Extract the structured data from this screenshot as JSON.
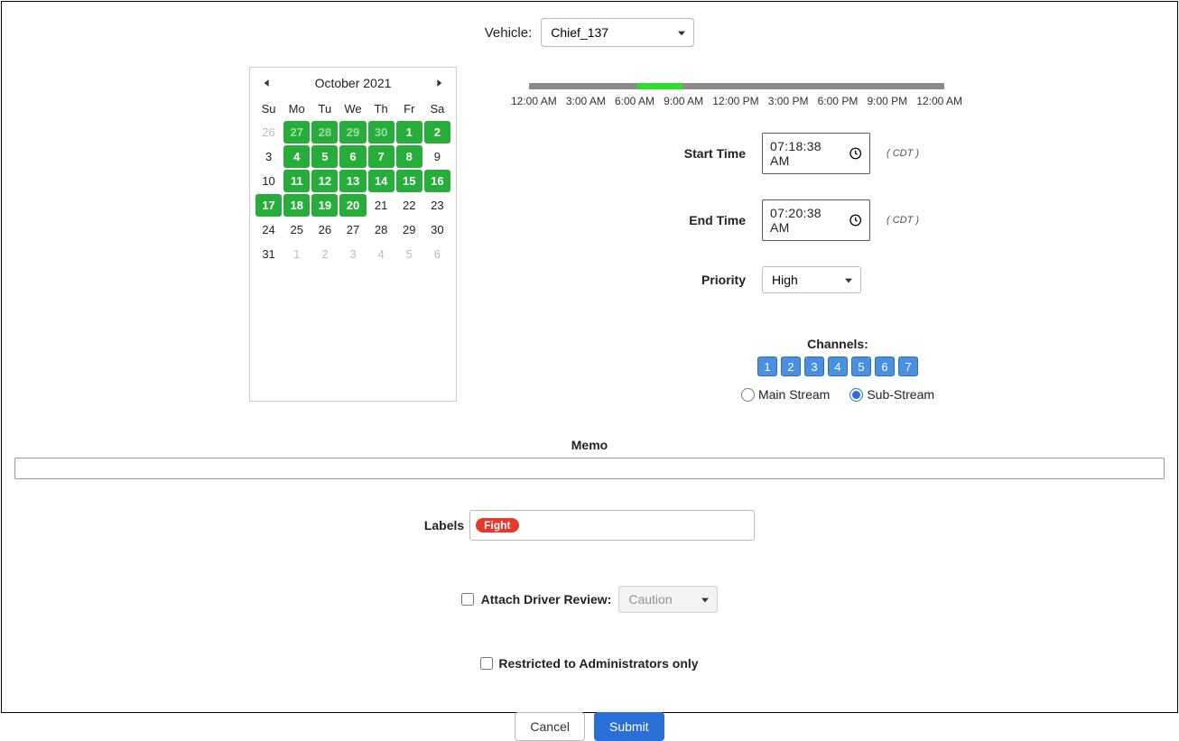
{
  "vehicle": {
    "label": "Vehicle:",
    "selected": "Chief_137"
  },
  "calendar": {
    "title": "October 2021",
    "dow": [
      "Su",
      "Mo",
      "Tu",
      "We",
      "Th",
      "Fr",
      "Sa"
    ],
    "days": [
      {
        "n": "26",
        "cls": "muted"
      },
      {
        "n": "27",
        "cls": "avail dim"
      },
      {
        "n": "28",
        "cls": "avail dim"
      },
      {
        "n": "29",
        "cls": "avail dim"
      },
      {
        "n": "30",
        "cls": "avail dim"
      },
      {
        "n": "1",
        "cls": "avail"
      },
      {
        "n": "2",
        "cls": "avail"
      },
      {
        "n": "3",
        "cls": ""
      },
      {
        "n": "4",
        "cls": "avail"
      },
      {
        "n": "5",
        "cls": "avail"
      },
      {
        "n": "6",
        "cls": "avail"
      },
      {
        "n": "7",
        "cls": "avail"
      },
      {
        "n": "8",
        "cls": "avail"
      },
      {
        "n": "9",
        "cls": ""
      },
      {
        "n": "10",
        "cls": ""
      },
      {
        "n": "11",
        "cls": "avail"
      },
      {
        "n": "12",
        "cls": "avail"
      },
      {
        "n": "13",
        "cls": "avail"
      },
      {
        "n": "14",
        "cls": "avail"
      },
      {
        "n": "15",
        "cls": "avail"
      },
      {
        "n": "16",
        "cls": "avail"
      },
      {
        "n": "17",
        "cls": "avail"
      },
      {
        "n": "18",
        "cls": "avail"
      },
      {
        "n": "19",
        "cls": "avail"
      },
      {
        "n": "20",
        "cls": "avail"
      },
      {
        "n": "21",
        "cls": ""
      },
      {
        "n": "22",
        "cls": ""
      },
      {
        "n": "23",
        "cls": ""
      },
      {
        "n": "24",
        "cls": ""
      },
      {
        "n": "25",
        "cls": ""
      },
      {
        "n": "26",
        "cls": ""
      },
      {
        "n": "27",
        "cls": ""
      },
      {
        "n": "28",
        "cls": ""
      },
      {
        "n": "29",
        "cls": ""
      },
      {
        "n": "30",
        "cls": ""
      },
      {
        "n": "31",
        "cls": ""
      },
      {
        "n": "1",
        "cls": "muted"
      },
      {
        "n": "2",
        "cls": "muted"
      },
      {
        "n": "3",
        "cls": "muted"
      },
      {
        "n": "4",
        "cls": "muted"
      },
      {
        "n": "5",
        "cls": "muted"
      },
      {
        "n": "6",
        "cls": "muted"
      }
    ]
  },
  "timeline": {
    "ticks": [
      "12:00 AM",
      "3:00 AM",
      "6:00 AM",
      "9:00 AM",
      "12:00 PM",
      "3:00 PM",
      "6:00 PM",
      "9:00 PM",
      "12:00 AM"
    ],
    "seg_left_pct": 26,
    "seg_width_pct": 11
  },
  "times": {
    "start_label": "Start Time",
    "start_value": "07:18:38 AM",
    "end_label": "End Time",
    "end_value": "07:20:38 AM",
    "tz": "( CDT )"
  },
  "priority": {
    "label": "Priority",
    "selected": "High"
  },
  "channels": {
    "label": "Channels:",
    "items": [
      "1",
      "2",
      "3",
      "4",
      "5",
      "6",
      "7"
    ]
  },
  "stream": {
    "main_label": "Main Stream",
    "sub_label": "Sub-Stream",
    "selected": "sub"
  },
  "memo": {
    "label": "Memo",
    "value": ""
  },
  "labels": {
    "label": "Labels",
    "tags": [
      "Fight"
    ]
  },
  "attach": {
    "label": "Attach Driver Review:",
    "checked": false,
    "selected": "Caution"
  },
  "restrict": {
    "label": "Restricted to Administrators only",
    "checked": false
  },
  "buttons": {
    "cancel": "Cancel",
    "submit": "Submit"
  }
}
